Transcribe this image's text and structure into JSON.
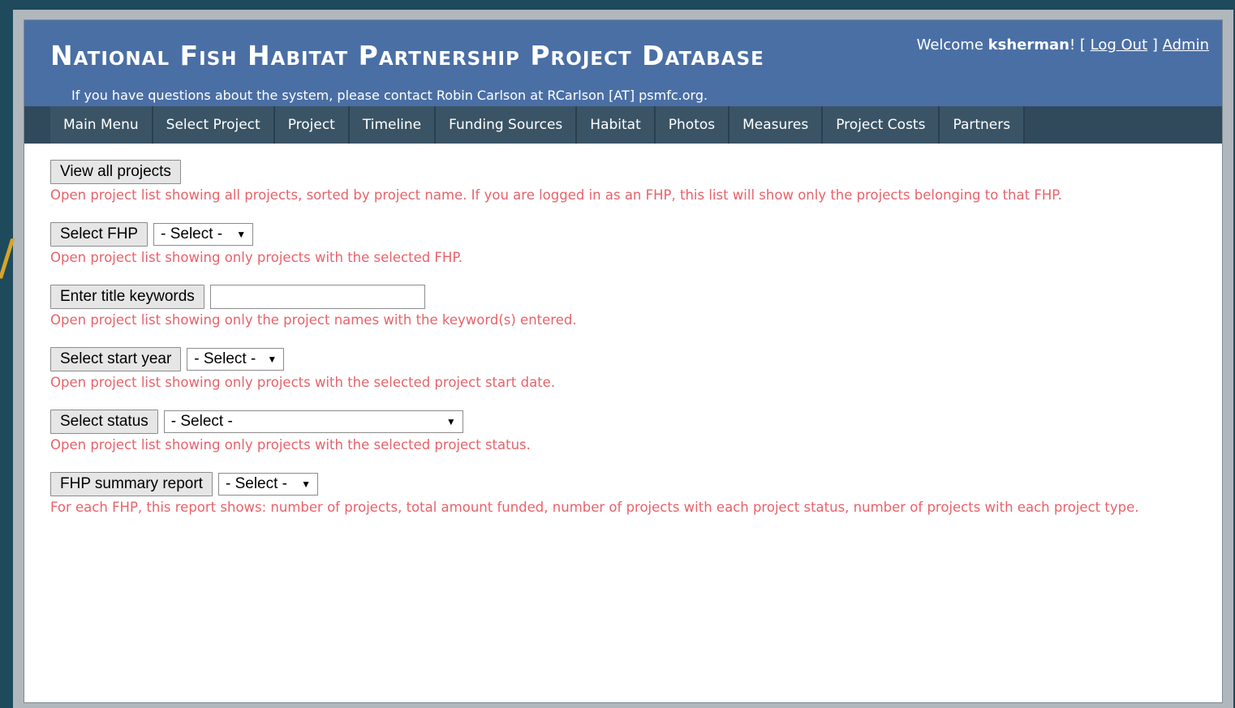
{
  "background": {
    "glyph": "/"
  },
  "header": {
    "title": "National Fish Habitat Partnership Project Database",
    "welcome_prefix": "Welcome ",
    "username": "ksherman",
    "welcome_suffix": "! [ ",
    "logout_label": "Log Out",
    "separator": " ] ",
    "admin_label": "Admin",
    "contact": "If you have questions about the system, please contact Robin Carlson at RCarlson [AT] psmfc.org."
  },
  "nav": {
    "items": [
      {
        "label": "Main Menu"
      },
      {
        "label": "Select Project"
      },
      {
        "label": "Project"
      },
      {
        "label": "Timeline"
      },
      {
        "label": "Funding Sources"
      },
      {
        "label": "Habitat"
      },
      {
        "label": "Photos"
      },
      {
        "label": "Measures"
      },
      {
        "label": "Project Costs"
      },
      {
        "label": "Partners"
      }
    ]
  },
  "search": {
    "view_all": {
      "button": "View all projects",
      "description": "Open project list showing all projects, sorted by project name. If you are logged in as an FHP, this list will show only the projects belonging to that FHP."
    },
    "fhp": {
      "button": "Select FHP",
      "select_value": "- Select -",
      "description": "Open project list showing only projects with the selected FHP."
    },
    "keywords": {
      "button": "Enter title keywords",
      "input_value": "",
      "description": "Open project list showing only the project names with the keyword(s) entered."
    },
    "start_year": {
      "button": "Select start year",
      "select_value": "- Select -",
      "description": "Open project list showing only projects with the selected project start date."
    },
    "status": {
      "button": "Select status",
      "select_value": "- Select -",
      "description": "Open project list showing only projects with the selected project status."
    },
    "summary": {
      "button": "FHP summary report",
      "select_value": "- Select -",
      "description": "For each FHP, this report shows: number of projects, total amount funded, number of projects with each project status, number of projects with each project type."
    }
  },
  "colors": {
    "header_bg": "#4a6fa5",
    "nav_bg": "#304a5c",
    "description_text": "#e8626a",
    "page_bg": "#1e4a5c"
  }
}
